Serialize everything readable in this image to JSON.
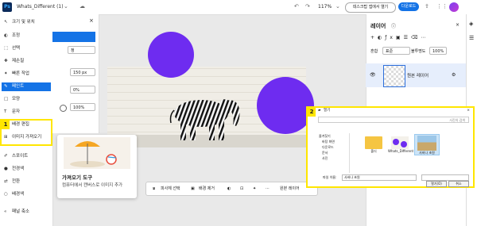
{
  "app": {
    "logo": "Ps",
    "doc_title": "Whats_Different (1)",
    "zoom": "117%"
  },
  "topbar": {
    "share_label": "데스크탑 앱에서 열기",
    "download_label": "다운로드"
  },
  "tools": [
    {
      "icon": "move-icon",
      "glyph": "↖",
      "label": "크기 및 위치"
    },
    {
      "icon": "adjust-icon",
      "glyph": "◐",
      "label": "조정"
    },
    {
      "icon": "select-icon",
      "glyph": "⬚",
      "label": "선택"
    },
    {
      "icon": "heal-icon",
      "glyph": "✚",
      "label": "제손질"
    },
    {
      "icon": "quick-action-icon",
      "glyph": "✦",
      "label": "빠른 작업"
    },
    {
      "icon": "brush-icon",
      "glyph": "✎",
      "label": "페인트"
    },
    {
      "icon": "shape-icon",
      "glyph": "□",
      "label": "모양"
    },
    {
      "icon": "text-icon",
      "glyph": "T",
      "label": "문자"
    },
    {
      "icon": "bg-edit-icon",
      "glyph": "▤",
      "label": "배경 편집"
    },
    {
      "icon": "import-image-icon",
      "glyph": "⊞",
      "label": "이미지 가져오기"
    },
    {
      "icon": "eyedropper-icon",
      "glyph": "✐",
      "label": "스포이트"
    },
    {
      "icon": "foreground-icon",
      "glyph": "●",
      "label": "전경색"
    },
    {
      "icon": "swap-icon",
      "glyph": "⇄",
      "label": "전환"
    },
    {
      "icon": "background-icon",
      "glyph": "○",
      "label": "배경색"
    },
    {
      "icon": "collapse-icon",
      "glyph": "«",
      "label": "패널 축소"
    }
  ],
  "settings": {
    "dropdown_value": "정",
    "size_value": "150 px",
    "pct1": "0%",
    "pct2": "100%"
  },
  "callouts": {
    "one": "1",
    "two": "2"
  },
  "tooltip": {
    "title": "가져오기 도구",
    "desc": "컴퓨터에서 캔버스로 이미지 추가"
  },
  "bottombar": {
    "subject_label": "피사체 선택",
    "remove_bg_label": "배경 제거",
    "source_layer_label": "원본 레이어"
  },
  "layers_panel": {
    "title": "레이어",
    "blend_label": "혼합",
    "blend_value": "표준",
    "opacity_label": "불투명도",
    "opacity_value": "100%",
    "layer_name": "원본 레이어"
  },
  "dialog": {
    "title": "열기",
    "path_hint": "",
    "search_placeholder": "사진의 검색",
    "sidebar": [
      "즐겨찾기",
      "바탕 화면",
      "다운로드",
      "문서",
      "사진"
    ],
    "files": [
      "폴더",
      "Whats_Different",
      "사바나 초원"
    ],
    "filename_label": "파일 이름:",
    "filename_value": "사바나 초원",
    "type_value": "",
    "open_label": "열기(O)",
    "cancel_label": "취소"
  },
  "colors": {
    "accent": "#1473e6",
    "purple": "#6e2cf0",
    "callout": "#ffe600"
  }
}
